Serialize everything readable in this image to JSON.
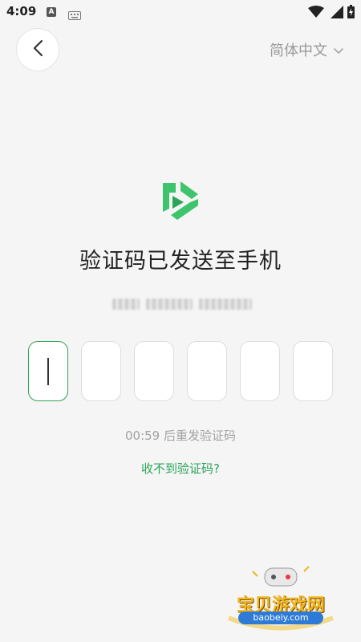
{
  "status_bar": {
    "time": "4:09",
    "a_icon": "A"
  },
  "header": {
    "back_icon": "chevron-left",
    "language": "简体中文"
  },
  "main": {
    "title": "验证码已发送至手机",
    "code_digits": [
      "",
      "",
      "",
      "",
      "",
      ""
    ],
    "resend_text": "00:59 后重发验证码",
    "help_link": "收不到验证码?"
  },
  "colors": {
    "accent": "#2aa55a",
    "background": "#f5f5f5"
  },
  "watermark": {
    "title": "宝贝游戏网",
    "url": "baobeiy.com"
  }
}
